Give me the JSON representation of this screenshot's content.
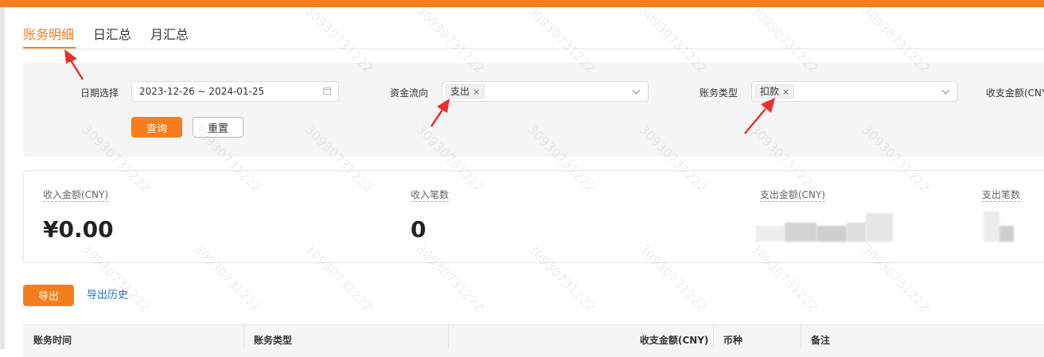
{
  "tabs": [
    {
      "label": "账务明细",
      "active": true
    },
    {
      "label": "日汇总",
      "active": false
    },
    {
      "label": "月汇总",
      "active": false
    }
  ],
  "filters": {
    "date_label": "日期选择",
    "date_value": "2023-12-26 ~ 2024-01-25",
    "flow_label": "资金流向",
    "flow_tag": "支出",
    "type_label": "账务类型",
    "type_tag": "扣款",
    "amount_label": "收支金额(CNY",
    "search_button": "查询",
    "reset_button": "重置",
    "tag_close": "×"
  },
  "summary": {
    "income_amount_label": "收入金额(CNY)",
    "income_amount_value": "¥0.00",
    "income_count_label": "收入笔数",
    "income_count_value": "0",
    "expense_amount_label": "支出金额(CNY)",
    "expense_count_label": "支出笔数"
  },
  "actions": {
    "export_button": "导出",
    "export_history_link": "导出历史"
  },
  "table": {
    "columns": [
      "账务时间",
      "账务类型",
      "收支金额(CNY)",
      "币种",
      "备注"
    ]
  },
  "watermark": "30930731222",
  "colors": {
    "accent": "#f77d1c",
    "link": "#1f6fd1",
    "annotation_arrow": "#e8302d"
  }
}
